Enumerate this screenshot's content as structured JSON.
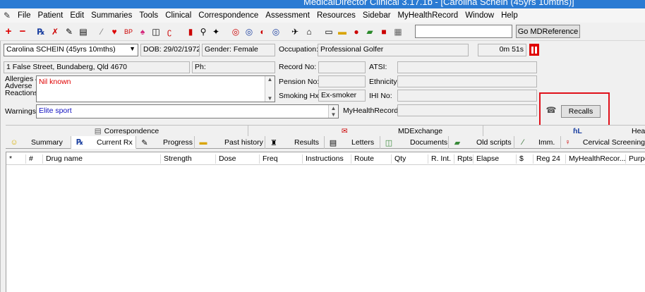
{
  "window": {
    "title": "MedicalDirector Clinical 3.17.1b - [Carolina Schein (45yrs 10mths)]"
  },
  "menu": [
    "File",
    "Patient",
    "Edit",
    "Summaries",
    "Tools",
    "Clinical",
    "Correspondence",
    "Assessment",
    "Resources",
    "Sidebar",
    "MyHealthRecord",
    "Window",
    "Help"
  ],
  "toolbar": {
    "search_value": "",
    "go_button": "Go MDReference"
  },
  "patient": {
    "name_select": "Carolina SCHEIN (45yrs 10mths)",
    "dob": "DOB: 29/02/1972",
    "gender": "Gender: Female",
    "occupation_label": "Occupation:",
    "occupation": "Professional Golfer",
    "timer": "0m 51s",
    "address": "1 False Street, Bundaberg, Qld  4670",
    "phone_label": "Ph:",
    "record_no_label": "Record No:",
    "atsi_label": "ATSI:",
    "pension_no_label": "Pension No:",
    "ethnicity_label": "Ethnicity:",
    "smoking_label": "Smoking Hx:",
    "smoking_value": "Ex-smoker",
    "ihi_label": "IHI No:",
    "allergies_label_1": "Allergies &",
    "allergies_label_2": "Adverse",
    "allergies_label_3": "Reactions:",
    "allergies_value": "Nil known",
    "warnings_label": "Warnings:",
    "warnings_value": "Elite sport",
    "mhr_label": "MyHealthRecord:",
    "recalls_button": "Recalls"
  },
  "group_tabs": [
    "Correspondence",
    "MDExchange",
    "Hea"
  ],
  "tabs": [
    "Summary",
    "Current Rx",
    "Progress",
    "Past history",
    "Results",
    "Letters",
    "Documents",
    "Old scripts",
    "Imm.",
    "Cervical Screening"
  ],
  "columns": [
    "*",
    "#",
    "Drug name",
    "Strength",
    "Dose",
    "Freq",
    "Instructions",
    "Route",
    "Qty",
    "R. Int.",
    "Rpts",
    "Elapse",
    "$",
    "Reg 24",
    "MyHealthRecor...",
    "Purpo"
  ],
  "colors": {
    "title_bar": "#2b7bd3",
    "highlight": "#e0101a",
    "allergy_text": "#e00000",
    "warning_text": "#1010c0"
  }
}
